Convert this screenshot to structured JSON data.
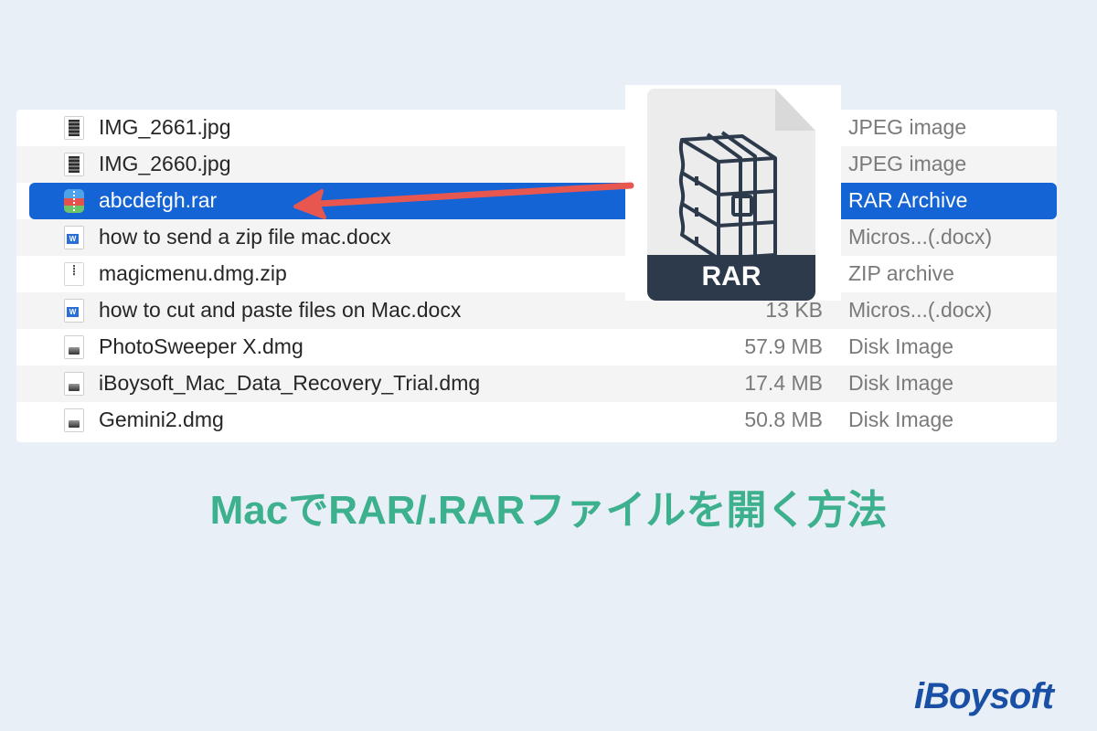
{
  "files": [
    {
      "name": "IMG_2661.jpg",
      "size": "",
      "kind": "JPEG image",
      "icon": "image-file-icon",
      "selected": false
    },
    {
      "name": "IMG_2660.jpg",
      "size": "",
      "kind": "JPEG image",
      "icon": "image-file-icon",
      "selected": false
    },
    {
      "name": "abcdefgh.rar",
      "size": "",
      "kind": "RAR Archive",
      "icon": "rar-archive-icon",
      "selected": true
    },
    {
      "name": "how to send a zip file mac.docx",
      "size": "",
      "kind": "Micros...(.docx)",
      "icon": "word-document-icon",
      "selected": false
    },
    {
      "name": "magicmenu.dmg.zip",
      "size": "",
      "kind": "ZIP archive",
      "icon": "zip-file-icon",
      "selected": false
    },
    {
      "name": "how to cut and paste files on Mac.docx",
      "size": "13 KB",
      "kind": "Micros...(.docx)",
      "icon": "word-document-icon",
      "selected": false
    },
    {
      "name": "PhotoSweeper X.dmg",
      "size": "57.9 MB",
      "kind": "Disk Image",
      "icon": "disk-image-icon",
      "selected": false
    },
    {
      "name": "iBoysoft_Mac_Data_Recovery_Trial.dmg",
      "size": "17.4 MB",
      "kind": "Disk Image",
      "icon": "disk-image-icon",
      "selected": false
    },
    {
      "name": "Gemini2.dmg",
      "size": "50.8 MB",
      "kind": "Disk Image",
      "icon": "disk-image-icon",
      "selected": false
    }
  ],
  "rar_icon": {
    "label": "RAR"
  },
  "headline": "MacでRAR/.RARファイルを開く方法",
  "brand": "iBoysoft",
  "colors": {
    "selection": "#1464d6",
    "headline": "#3db08e",
    "brand": "#1a4fa6",
    "arrow": "#e8574f",
    "rar_band": "#2c3a4b"
  }
}
